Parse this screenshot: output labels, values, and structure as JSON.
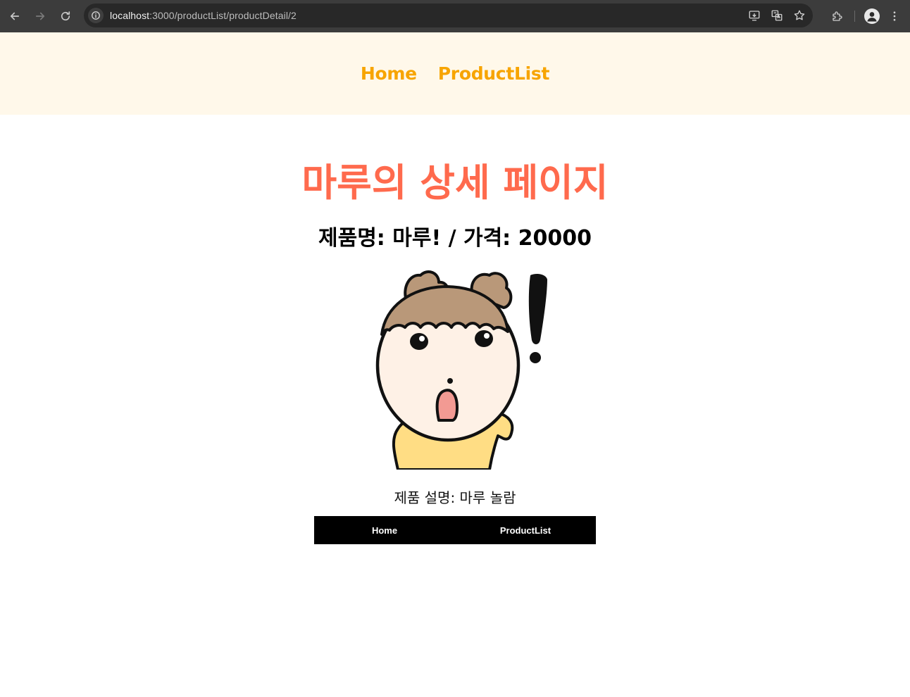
{
  "browser": {
    "url_host": "localhost",
    "url_rest": ":3000/productList/productDetail/2"
  },
  "header": {
    "nav": [
      {
        "label": "Home"
      },
      {
        "label": "ProductList"
      }
    ]
  },
  "page": {
    "title": "마루의 상세 페이지",
    "product_info": "제품명: 마루! / 가격: 20000",
    "description": "제품 설명: 마루 놀람"
  },
  "bottom_nav": [
    {
      "label": "Home"
    },
    {
      "label": "ProductList"
    }
  ],
  "colors": {
    "header_bg": "#fff8ea",
    "header_link": "#f7a400",
    "title": "#ff6a4d",
    "bottom_nav_bg": "#000000"
  }
}
